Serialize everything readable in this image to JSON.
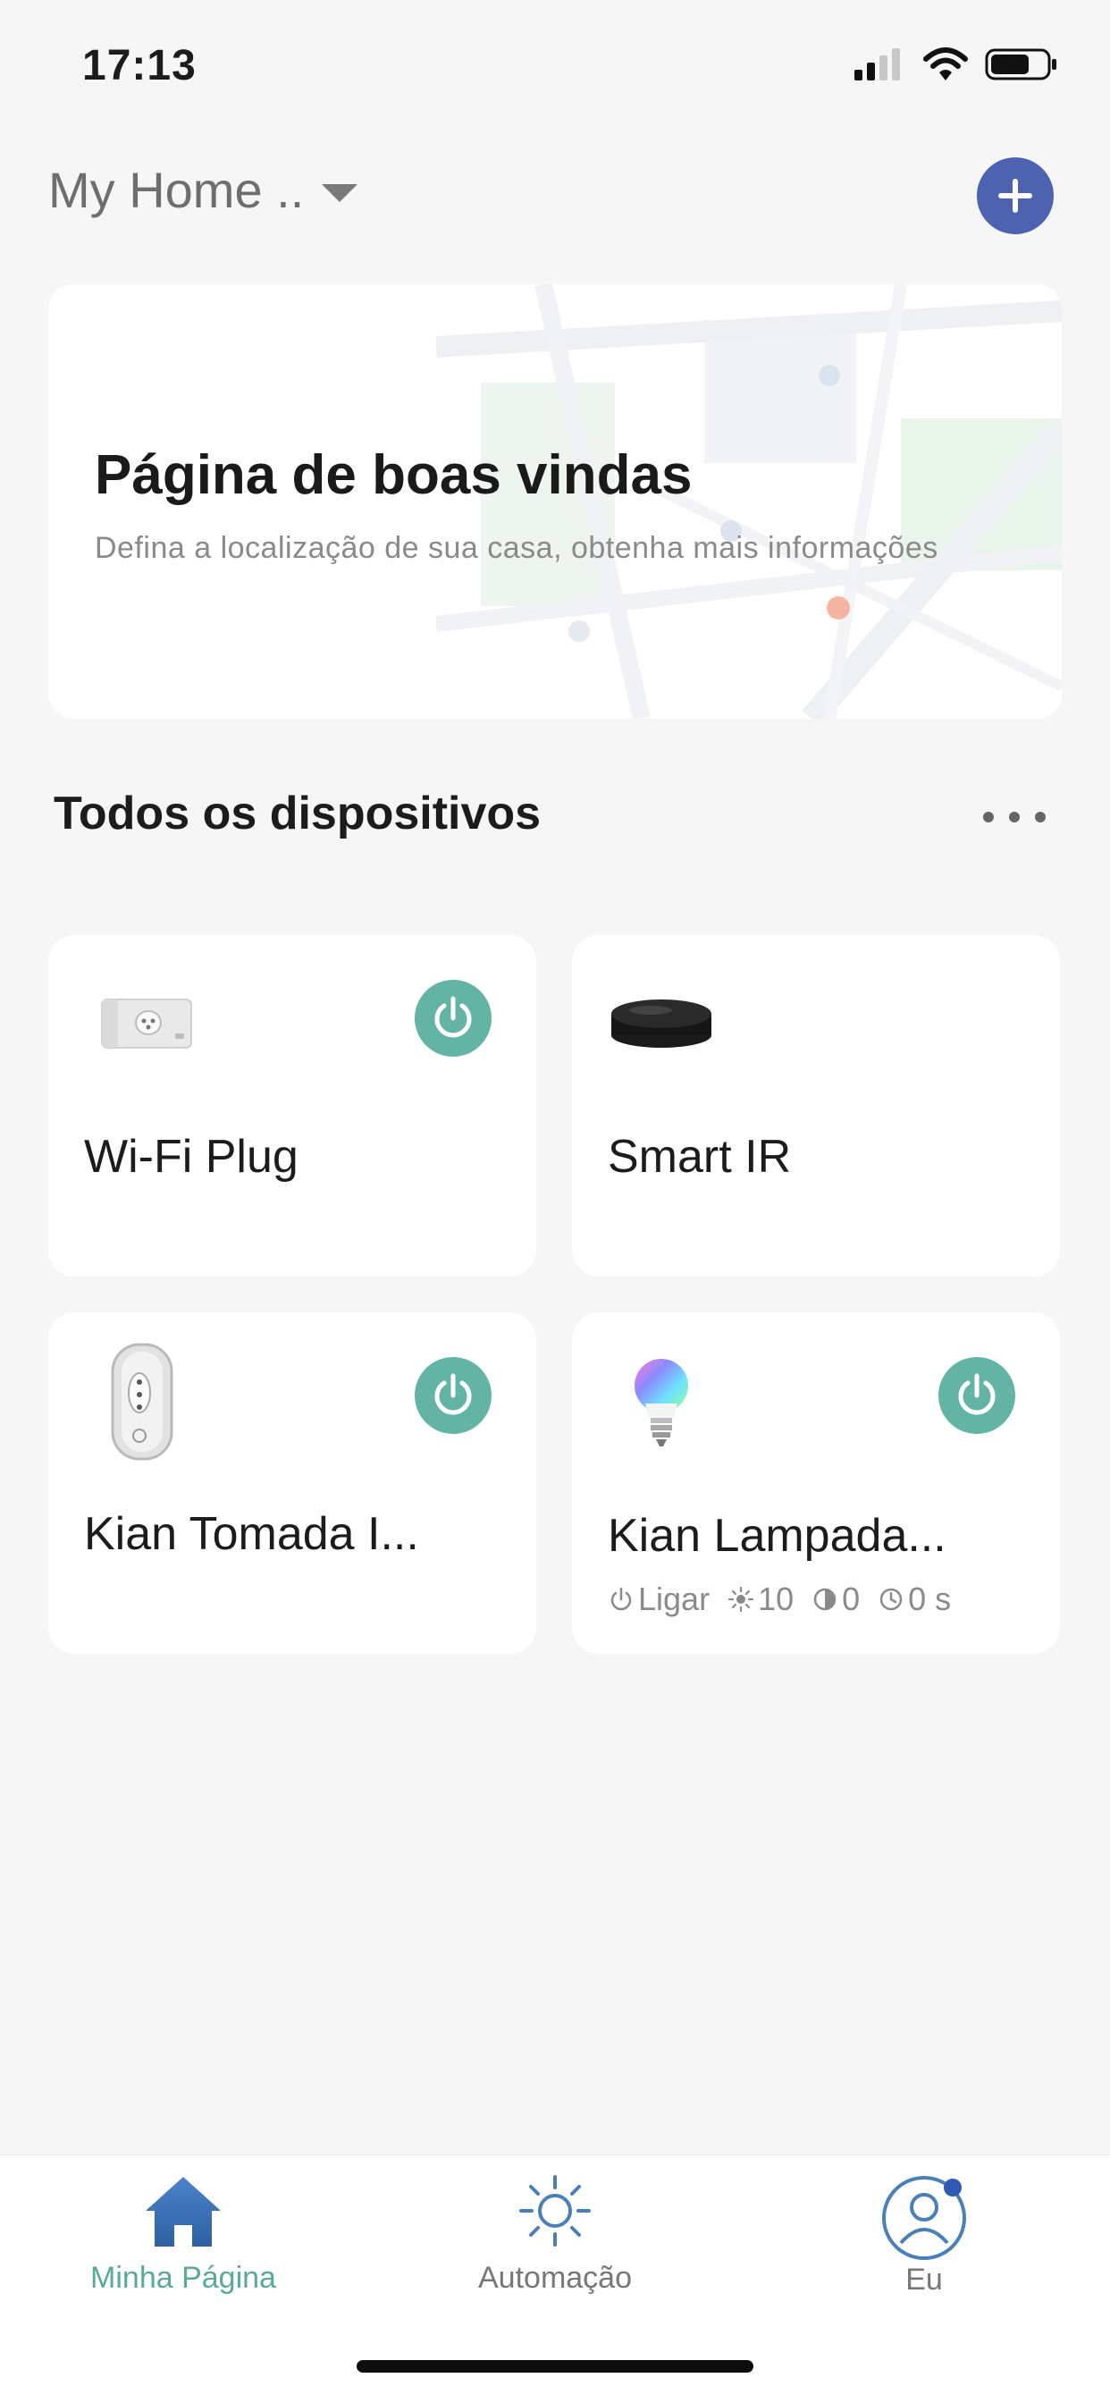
{
  "status_bar": {
    "time": "17:13"
  },
  "header": {
    "home_name": "My Home ..",
    "add_icon": "plus-icon"
  },
  "welcome": {
    "title": "Página de boas vindas",
    "subtitle": "Defina a localização de sua casa, obtenha mais informações"
  },
  "devices_section": {
    "title": "Todos os dispositivos"
  },
  "devices": [
    {
      "name": "Wi-Fi Plug",
      "icon": "wifi-plug-icon",
      "has_power": true
    },
    {
      "name": "Smart IR",
      "icon": "smart-ir-icon",
      "has_power": false
    },
    {
      "name": "Kian Tomada I...",
      "icon": "wall-socket-icon",
      "has_power": true
    },
    {
      "name": "Kian Lampada...",
      "icon": "rgb-bulb-icon",
      "has_power": true,
      "status": {
        "power": "Ligar",
        "brightness": "10",
        "contrast": "0",
        "timer": "0 s"
      }
    }
  ],
  "tabs": [
    {
      "label": "Minha Página",
      "icon": "home-icon",
      "active": true
    },
    {
      "label": "Automação",
      "icon": "sun-icon",
      "active": false
    },
    {
      "label": "Eu",
      "icon": "profile-icon",
      "active": false
    }
  ],
  "colors": {
    "accent_green": "#64b4a6",
    "add_button_blue": "#4e63b0",
    "tab_active": "#5aa99b",
    "tab_inactive": "#777777",
    "background": "#f6f6f6"
  }
}
